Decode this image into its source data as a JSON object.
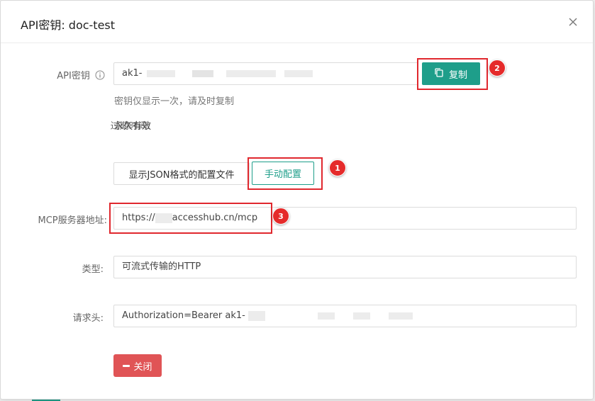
{
  "modal": {
    "title": "API密钥: doc-test"
  },
  "api_key": {
    "label": "API密钥",
    "value_prefix": "ak1-",
    "copy_label": "复制",
    "hint": "密钥仅显示一次，请及时复制"
  },
  "expiry": {
    "label": "过期时间:",
    "value": "永久有效"
  },
  "tabs": {
    "json_label": "显示JSON格式的配置文件",
    "manual_label": "手动配置"
  },
  "mcp": {
    "label": "MCP服务器地址:",
    "value_prefix": "https://",
    "value_suffix": "accesshub.cn/mcp"
  },
  "type": {
    "label": "类型:",
    "value": "可流式传输的HTTP"
  },
  "headers": {
    "label": "请求头:",
    "value_prefix": "Authorization=Bearer ak1-"
  },
  "close_label": "关闭",
  "badges": [
    "1",
    "2",
    "3"
  ],
  "colors": {
    "primary": "#1e9e8a",
    "danger": "#e05456",
    "highlight": "#e0282e"
  }
}
